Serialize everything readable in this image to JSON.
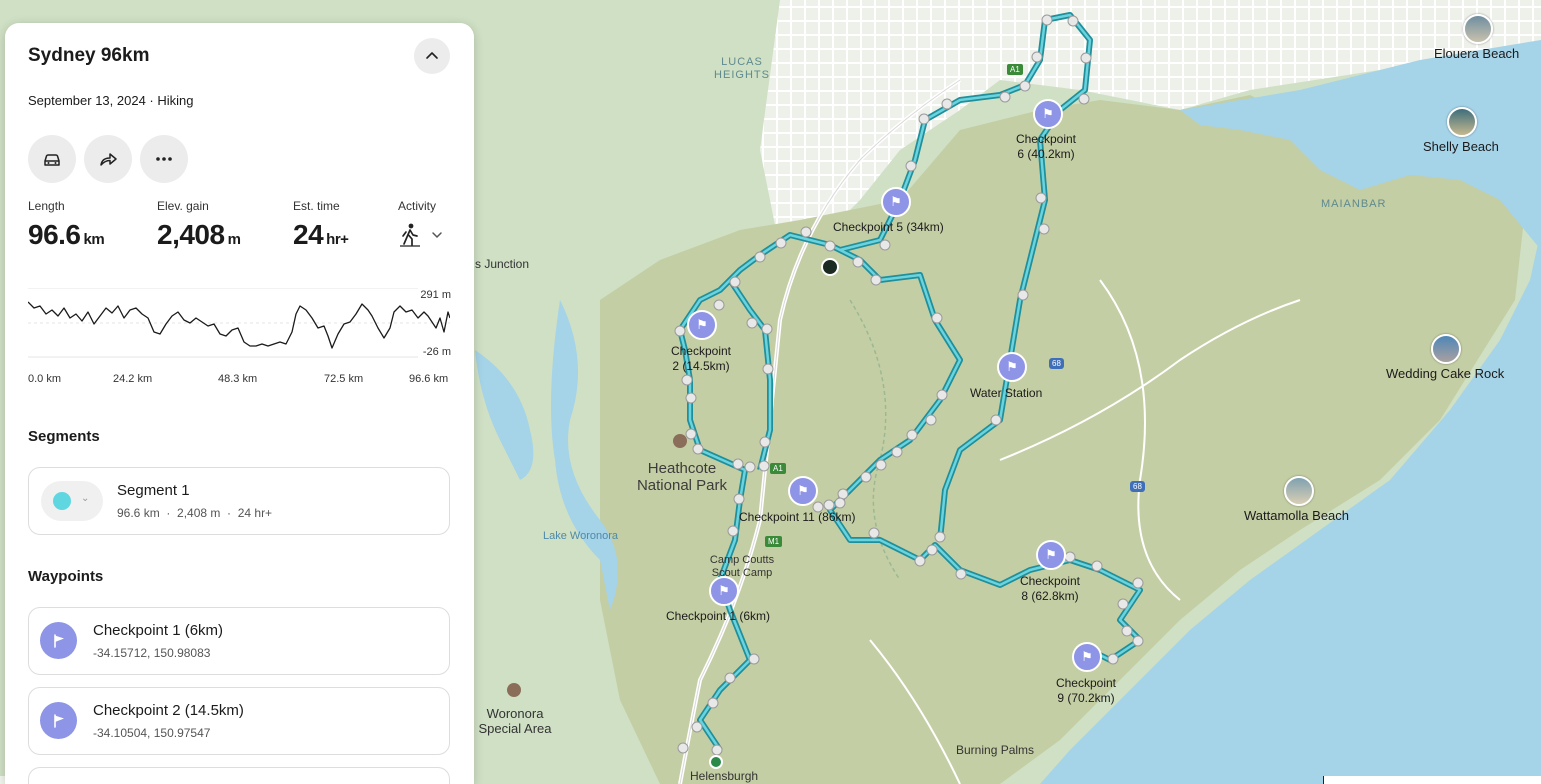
{
  "panel": {
    "title": "Sydney 96km",
    "subtitle": "September 13, 2024 · Hiking",
    "actions": [
      {
        "name": "drive-icon",
        "label": ""
      },
      {
        "name": "share-icon",
        "label": ""
      },
      {
        "name": "more-icon",
        "label": ""
      }
    ],
    "stats": {
      "length_label": "Length",
      "length_value": "96.6",
      "length_unit": "km",
      "elev_label": "Elev. gain",
      "elev_value": "2,408",
      "elev_unit": "m",
      "time_label": "Est. time",
      "time_value": "24",
      "time_unit": "hr+",
      "activity_label": "Activity",
      "activity_icon": "hiker-icon"
    },
    "elevation_profile": {
      "max_label": "291 m",
      "min_label": "-26 m",
      "x_ticks": [
        "0.0 km",
        "24.2 km",
        "48.3 km",
        "72.5 km",
        "96.6 km"
      ]
    },
    "segments_title": "Segments",
    "segment": {
      "name": "Segment 1",
      "detail": "96.6 km  ·  2,408 m  ·  24 hr+",
      "color": "#5fd6e0"
    },
    "waypoints_title": "Waypoints",
    "waypoints": [
      {
        "name": "Checkpoint 1 (6km)",
        "coords": "-34.15712, 150.98083"
      },
      {
        "name": "Checkpoint 2 (14.5km)",
        "coords": "-34.10504, 150.97547"
      }
    ]
  },
  "map": {
    "route_color": "#27a7b5",
    "places": {
      "lucas_heights": "LUCAS\nHEIGHTS",
      "junction": "s Junction",
      "heathcote": "Heathcote\nNational Park",
      "lake_woronora": "Lake Woronora",
      "woronora": "Woronora\nSpecial Area",
      "camp_coutts": "Camp Coutts\nScout Camp",
      "helensburgh": "Helensburgh",
      "burning_palms": "Burning Palms",
      "maianbar": "MAIANBAR"
    },
    "beaches": [
      "Elouera Beach",
      "Shelly Beach",
      "Wedding Cake Rock",
      "Wattamolla Beach"
    ],
    "checkpoints": [
      "Checkpoint\n6 (40.2km)",
      "Checkpoint 5 (34km)",
      "Checkpoint\n2 (14.5km)",
      "Water Station",
      "Checkpoint 11 (86km)",
      "Checkpoint\n8 (62.8km)",
      "Checkpoint 1 (6km)",
      "Checkpoint\n9 (70.2km)"
    ],
    "road_badges": [
      "A1",
      "A1",
      "M1",
      "68",
      "68"
    ]
  }
}
